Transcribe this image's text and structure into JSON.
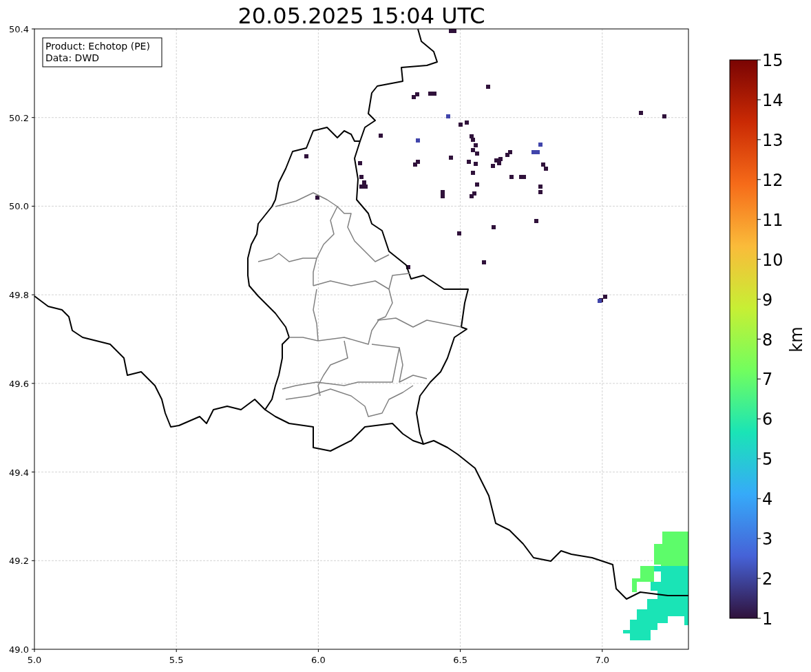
{
  "title": "20.05.2025 15:04 UTC",
  "info_box": {
    "lines": [
      "Product: Echotop (PE)",
      "Data: DWD"
    ]
  },
  "map": {
    "xticks": [
      "5.0",
      "5.5",
      "6.0",
      "6.5",
      "7.0"
    ],
    "yticks": [
      "50.4",
      "50.2",
      "50.0",
      "49.8",
      "49.6",
      "49.4",
      "49.2",
      "49.0"
    ]
  },
  "colorbar": {
    "label": "km",
    "ticks": [
      "15",
      "14",
      "13",
      "12",
      "11",
      "10",
      "9",
      "8",
      "7",
      "6",
      "5",
      "4",
      "3",
      "2",
      "1"
    ]
  }
}
